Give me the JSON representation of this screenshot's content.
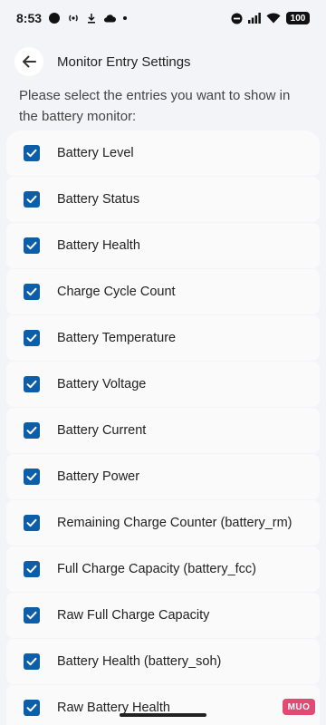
{
  "status_bar": {
    "time": "8:53",
    "battery": "100"
  },
  "header": {
    "title": "Monitor Entry Settings"
  },
  "instructions": "Please select the entries you want to show in the battery monitor:",
  "entries": [
    {
      "label": "Battery Level",
      "checked": true
    },
    {
      "label": "Battery Status",
      "checked": true
    },
    {
      "label": "Battery Health",
      "checked": true
    },
    {
      "label": "Charge Cycle Count",
      "checked": true
    },
    {
      "label": "Battery Temperature",
      "checked": true
    },
    {
      "label": "Battery Voltage",
      "checked": true
    },
    {
      "label": "Battery Current",
      "checked": true
    },
    {
      "label": "Battery Power",
      "checked": true
    },
    {
      "label": "Remaining Charge Counter (battery_rm)",
      "checked": true
    },
    {
      "label": "Full Charge Capacity (battery_fcc)",
      "checked": true
    },
    {
      "label": "Raw Full Charge Capacity",
      "checked": true
    },
    {
      "label": "Battery Health (battery_soh)",
      "checked": true
    },
    {
      "label": "Raw Battery Health",
      "checked": true
    }
  ],
  "watermark": "MUO",
  "colors": {
    "accent": "#0d5ea8",
    "background": "#f3f4f7",
    "row": "#fafafb"
  }
}
